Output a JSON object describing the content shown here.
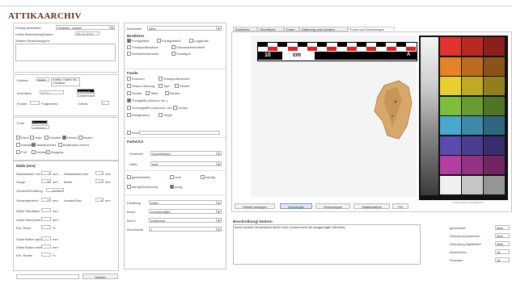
{
  "app": {
    "title": "ATTIKAARCHIV"
  },
  "left": {
    "top": {
      "f1_label": "Eintrag bearbeitet",
      "f1_value": "Grafnetz, Leonie",
      "f2_label": "Letzte Bearbeitung/Datum",
      "f2_value": "09.10.2020",
      "f3_label": "Weitere Bearbeitung/en:"
    },
    "mid": {
      "kontext_label": "Kontext",
      "kontext_value": "B/001",
      "kontext_desc": "Antike, Kalt/b Inv.-Christian",
      "inventar_label": "Inventarnr.",
      "inventar_value": "ALD-1",
      "dark1": "Keramik",
      "dark2": "Gefäß/Gefäßteil",
      "fund_label": "Fundnr.",
      "fragment_label": "Fragmentnr.",
      "zaehler_label": "Zählnr.",
      "zaehler_value": "1"
    },
    "form": {
      "label": "Form",
      "dark1": "Fragment/Scherbe",
      "dark2": "unförmig",
      "checks": [
        {
          "label": "Rand",
          "on": false
        },
        {
          "label": "Hals",
          "on": false
        },
        {
          "label": "Schulter",
          "on": false
        },
        {
          "label": "Henkel",
          "on": true
        },
        {
          "label": "Boden",
          "on": false
        },
        {
          "label": "Wandst.",
          "on": false
        },
        {
          "label": "Wandscherbe",
          "on": true
        },
        {
          "label": "Bodenrand rezent",
          "on": false
        },
        {
          "label": "Fuß",
          "on": false
        },
        {
          "label": "Deckel",
          "on": false
        },
        {
          "label": "Ausguss",
          "on": false
        }
      ]
    },
    "measures": {
      "title": "Maße (mm)",
      "rows": [
        {
          "a": "Wandstärke: min.",
          "av": "3",
          "au": "mm",
          "b": "Wandstärke max.",
          "bv": "4",
          "bu": "mm"
        },
        {
          "a": "Länge",
          "av": "26",
          "au": "mm",
          "b": "Breite",
          "bv": "12",
          "bu": "mm"
        },
        {
          "a": "Gewicht/Erhaltung",
          "av": "erhalten",
          "au": "",
          "b": "",
          "bv": "",
          "bu": ""
        },
        {
          "a": "Gesamtgewicht",
          "av": "21",
          "au": "mm",
          "b": "Anzahl/Gew.",
          "bv": "8",
          "bu": "mm"
        },
        {
          "a": "Dicke Randlippe",
          "av": "",
          "au": "mm",
          "b": "",
          "bv": "",
          "bu": ""
        },
        {
          "a": "Dicke Rand innen",
          "av": "",
          "au": "mm",
          "b": "",
          "bv": "",
          "bu": ""
        },
        {
          "a": "Erh. Rand",
          "av": "",
          "au": "%",
          "b": "",
          "bv": "",
          "bu": ""
        },
        {
          "a": "Dicke Boden außen",
          "av": "",
          "au": "mm",
          "b": "",
          "bv": "",
          "bu": ""
        },
        {
          "a": "Dicke Boden innen",
          "av": "",
          "au": "mm",
          "b": "",
          "bv": "",
          "bu": ""
        },
        {
          "a": "Erh. Boden",
          "av": "",
          "au": "%",
          "b": "",
          "bv": "",
          "bu": ""
        }
      ]
    },
    "search_button": "Suchen"
  },
  "center": {
    "bearbeiter_label": "Bearbeiter",
    "bearbeiter_value": "offen",
    "bereichte_title": "Berührtes",
    "bereichte_checks": [
      {
        "label": "Fundgefäße",
        "on": true
      },
      {
        "label": "Fundgefäße2",
        "on": false
      },
      {
        "label": "Luggeräte",
        "on": false
      },
      {
        "label": "Transportamphore",
        "on": false
      },
      {
        "label": "Glanzwarenkeramik",
        "on": false
      },
      {
        "label": "Architekturkeramik",
        "on": false
      },
      {
        "label": "Sonstiges",
        "on": false
      }
    ],
    "fund_title": "Funde",
    "fund_checks": [
      {
        "label": "Knochen",
        "on": false
      },
      {
        "label": "Transportamphore",
        "on": false
      },
      {
        "label": "Glasur-Überzug",
        "on": false
      },
      {
        "label": "Topf",
        "on": false
      },
      {
        "label": "Deckel",
        "on": false
      },
      {
        "label": "Schale",
        "on": false
      },
      {
        "label": "Teller",
        "on": false
      },
      {
        "label": "Becher",
        "on": false
      },
      {
        "label": "Trinkgefäß (Becher, etc.)",
        "on": true
      },
      {
        "label": "Vorratsgefäß (Amphora, etc.)",
        "on": false
      },
      {
        "label": "Lampe",
        "on": false
      },
      {
        "label": "Webgewicht",
        "on": false
      },
      {
        "label": "Tiegel",
        "on": false
      },
      {
        "label": "Sonstiges",
        "on": false
      }
    ],
    "farbe_title": "Farbe/Art",
    "farbe1_label": "Scherben",
    "farbe1_value": "Dunkelbraun",
    "farbe2_label": "Härte",
    "farbe2_value": "hart",
    "misc_checks": [
      {
        "label": "geschmiedet",
        "on": false
      },
      {
        "label": "rauh",
        "on": false
      },
      {
        "label": "sandig",
        "on": false
      },
      {
        "label": "körnig/Schlemmig",
        "on": false
      },
      {
        "label": "porig",
        "on": true
      }
    ],
    "drop_rows": [
      {
        "label": "Erhaltung",
        "value": "mittel"
      },
      {
        "label": "Bruch",
        "value": "unregelmäßig"
      },
      {
        "label": "Bruch",
        "value": "unter/unig"
      },
      {
        "label": "Bruchkante",
        "value": "1"
      }
    ]
  },
  "right": {
    "tabs": [
      "Erstellfoto",
      "Oberfläche",
      "Farbe",
      "Datierung und Literatur",
      "Fotos und Zeichnungen"
    ],
    "scale": {
      "n1": "10",
      "n2": "cm",
      "n3": "A"
    },
    "buttons": [
      "Einheit anzeigen",
      "Hinzufügen",
      "Zeichnungen",
      "Skalierbarkeit",
      "Fix"
    ],
    "caption": "Farbwertskala ist ein Indikator 5.5",
    "desc_title": "Beschreibung/ Notizen",
    "desc_text": "leicht schiefe Henkelstück leicht innen (Unmenschl mit ausgeprägte Wehnde)",
    "side_rows": [
      {
        "label": "gezeichnet",
        "value": "Nein"
      },
      {
        "label": "Zeichnung kolorieren",
        "value": "Nein"
      },
      {
        "label": "Zeichnung digitalisiert",
        "value": "Nein"
      },
      {
        "label": "Abzeichnen",
        "value": "Ja"
      },
      {
        "label": "Einscann",
        "value": "Ja"
      }
    ]
  },
  "colors": {
    "chart_colors": [
      "#e1322b",
      "#e48426",
      "#e8cf2d",
      "#7dbf3a",
      "#4aa8cf",
      "#5a4bb0",
      "#b33ea0",
      "#f0f0f0"
    ]
  }
}
